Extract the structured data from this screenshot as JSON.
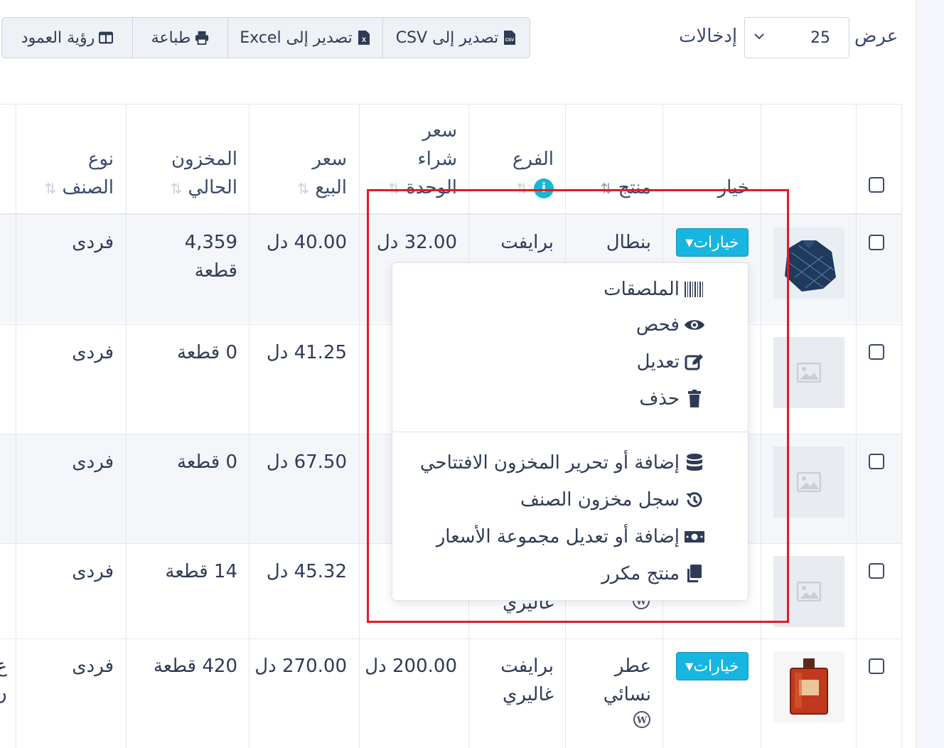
{
  "controls": {
    "show_label": "عرض",
    "entries_value": "25",
    "entries_label": "إدخالات",
    "buttons": {
      "csv": "تصدير إلى CSV",
      "excel": "تصدير إلى Excel",
      "print": "طباعة",
      "columns": "رؤية العمود"
    }
  },
  "table": {
    "headers": {
      "option": "خيار",
      "product": "منتج",
      "branch": "الفرع",
      "purchase_price": [
        "سعر",
        "شراء",
        "الوحدة"
      ],
      "sell_price": [
        "سعر",
        "البيع"
      ],
      "stock": [
        "المخزون",
        "الحالي"
      ],
      "type": [
        "نوع",
        "الصنف"
      ]
    },
    "options_label": "خيارات",
    "rows": [
      {
        "product": "بنطال",
        "branch": "برايفت",
        "purchase": "32.00 دل",
        "price": "40.00 دل",
        "stock": [
          "4,359",
          "قطعة"
        ],
        "type": "فردى"
      },
      {
        "product": "",
        "branch": "",
        "purchase": "",
        "price": "41.25 دل",
        "stock": [
          "0 قطعة"
        ],
        "type": "فردى"
      },
      {
        "product": "",
        "branch": "",
        "purchase": "",
        "price": "67.50 دل",
        "stock": [
          "0 قطعة"
        ],
        "type": "فردى"
      },
      {
        "product": "",
        "branch": "غاليري",
        "purchase": "",
        "price": "45.32 دل",
        "stock": [
          "14 قطعة"
        ],
        "type": "فردى"
      },
      {
        "product": [
          "عطر",
          "نسائي"
        ],
        "branch": [
          "برايفت",
          "غاليري"
        ],
        "purchase": "200.00 دل",
        "price": "270.00 دل",
        "stock": [
          "420 قطعة"
        ],
        "type": "فردى"
      }
    ],
    "partial_right_col": [
      "ع",
      "ن"
    ]
  },
  "dropdown": {
    "items": [
      {
        "label": "الملصقات",
        "icon": "barcode-icon"
      },
      {
        "label": "فحص",
        "icon": "eye-icon"
      },
      {
        "label": "تعديل",
        "icon": "edit-icon"
      },
      {
        "label": "حذف",
        "icon": "trash-icon"
      },
      {
        "label": "إضافة أو تحرير المخزون الافتتاحي",
        "icon": "database-icon"
      },
      {
        "label": "سجل مخزون الصنف",
        "icon": "history-icon"
      },
      {
        "label": "إضافة أو تعديل مجموعة الأسعار",
        "icon": "money-icon"
      },
      {
        "label": "منتج مكرر",
        "icon": "copy-icon"
      }
    ]
  },
  "colors": {
    "accent": "#17b6e0",
    "highlight": "#e31b23",
    "text": "#2f3b55"
  }
}
